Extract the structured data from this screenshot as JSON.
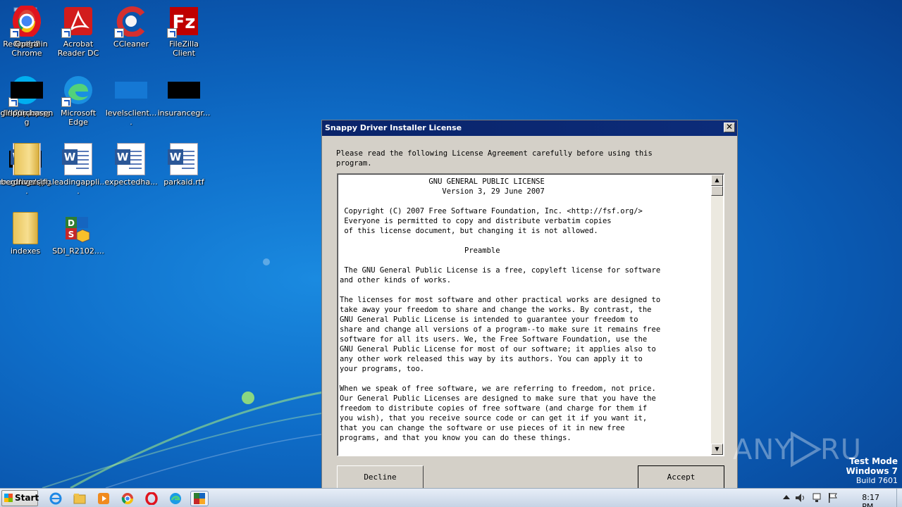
{
  "desktop": {
    "icons": [
      {
        "label": "Recycle Bin",
        "icon": "recycle-bin-icon"
      },
      {
        "label": "Skype",
        "icon": "skype-icon"
      },
      {
        "label": "musthard.jpg",
        "icon": "image-thumbnail-icon"
      },
      {
        "label": "indexes",
        "icon": "folder-icon"
      },
      {
        "label": "Acrobat Reader DC",
        "icon": "acrobat-icon"
      },
      {
        "label": "Microsoft Edge",
        "icon": "edge-icon"
      },
      {
        "label": "leadingappli...",
        "icon": "word-doc-icon"
      },
      {
        "label": "SDI_R2102....",
        "icon": "sdi-icon"
      },
      {
        "label": "CCleaner",
        "icon": "ccleaner-icon"
      },
      {
        "label": "levelsclient....",
        "icon": "image-thumbnail-icon"
      },
      {
        "label": "expectedha...",
        "icon": "word-doc-icon"
      },
      {
        "label": "FileZilla Client",
        "icon": "filezilla-icon"
      },
      {
        "label": "insurancegr...",
        "icon": "image-thumbnail-icon"
      },
      {
        "label": "parkaid.rtf",
        "icon": "word-doc-icon"
      },
      {
        "label": "Firefox",
        "icon": "firefox-icon"
      },
      {
        "label": "fileview.png",
        "icon": "image-thumbnail-icon"
      },
      {
        "label": "beginspecifi...",
        "icon": "word-doc-icon"
      },
      {
        "label": "Google Chrome",
        "icon": "chrome-icon"
      },
      {
        "label": "dieopinion.png",
        "icon": "image-thumbnail-icon"
      },
      {
        "label": "logs",
        "icon": "folder-icon"
      },
      {
        "label": "Opera",
        "icon": "opera-icon"
      },
      {
        "label": "girlpurchase....",
        "icon": "image-thumbnail-icon"
      },
      {
        "label": "drivers",
        "icon": "folder-icon"
      }
    ]
  },
  "dialog": {
    "title": "Snappy Driver Installer License",
    "close_label": "✕",
    "message": "Please read the following License Agreement carefully before using this\nprogram.",
    "license_text": "                    GNU GENERAL PUBLIC LICENSE\n                       Version 3, 29 June 2007\n\n Copyright (C) 2007 Free Software Foundation, Inc. <http://fsf.org/>\n Everyone is permitted to copy and distribute verbatim copies\n of this license document, but changing it is not allowed.\n\n                            Preamble\n\n The GNU General Public License is a free, copyleft license for software\nand other kinds of works.\n\nThe licenses for most software and other practical works are designed to\ntake away your freedom to share and change the works. By contrast, the\nGNU General Public License is intended to guarantee your freedom to\nshare and change all versions of a program--to make sure it remains free\nsoftware for all its users. We, the Free Software Foundation, use the\nGNU General Public License for most of our software; it applies also to\nany other work released this way by its authors. You can apply it to\nyour programs, too.\n\nWhen we speak of free software, we are referring to freedom, not price.\nOur General Public Licenses are designed to make sure that you have the\nfreedom to distribute copies of free software (and charge for them if\nyou wish), that you receive source code or can get it if you want it,\nthat you can change the software or use pieces of it in new free\nprograms, and that you know you can do these things.",
    "decline_label": "Decline",
    "accept_label": "Accept"
  },
  "watermark": {
    "brand": "ANY RUN",
    "test_mode": "Test Mode",
    "os": "Windows 7",
    "build": "Build 7601"
  },
  "taskbar": {
    "start_label": "Start",
    "pinned": [
      "ie-icon",
      "explorer-icon",
      "media-player-icon",
      "chrome-icon",
      "opera-icon",
      "edge-icon",
      "sdi-icon"
    ],
    "clock": "8:17 PM"
  },
  "colors": {
    "titlebar": "#0a246a",
    "dialog_bg": "#d4d0c8",
    "desktop_blue": "#0f6fca"
  }
}
